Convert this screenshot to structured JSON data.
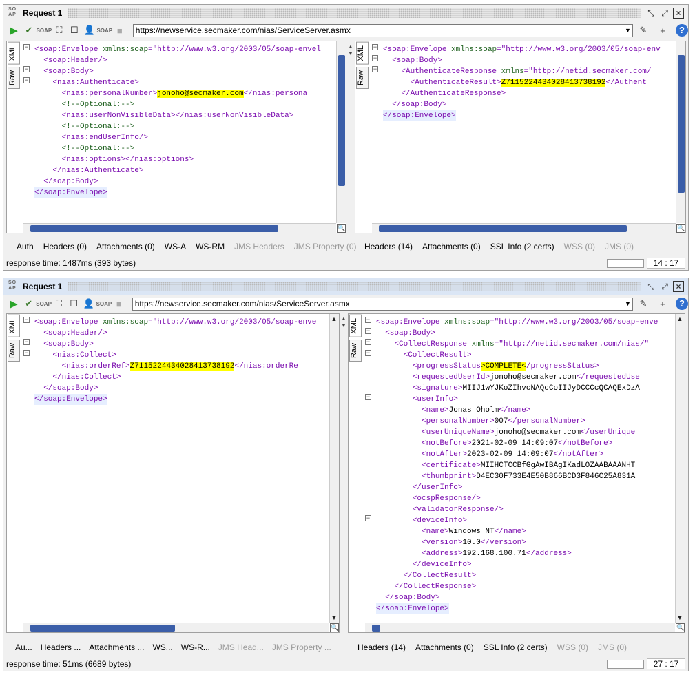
{
  "panel1": {
    "logo": "SO AP",
    "title": "Request 1",
    "url": "https://newservice.secmaker.com/nias/ServiceServer.asmx",
    "left_tabs": [
      "XML",
      "Raw"
    ],
    "right_tabs": [
      "XML",
      "Raw"
    ],
    "req_lines": [
      [
        [
          "t",
          "<soap:Envelope "
        ],
        [
          "a",
          "xmlns:soap"
        ],
        [
          "t",
          "="
        ],
        [
          "v",
          "\"http://www.w3.org/2003/05/soap-envel"
        ]
      ],
      [
        [
          "sp",
          "  "
        ],
        [
          "t",
          "<soap:Header/>"
        ]
      ],
      [
        [
          "sp",
          "  "
        ],
        [
          "t",
          "<soap:Body>"
        ]
      ],
      [
        [
          "sp",
          "    "
        ],
        [
          "t",
          "<nias:Authenticate>"
        ]
      ],
      [
        [
          "sp",
          "      "
        ],
        [
          "t",
          "<nias:personalNumber>"
        ],
        [
          "h",
          "jonoho@secmaker.com"
        ],
        [
          "t",
          "</nias:persona"
        ]
      ],
      [
        [
          "sp",
          "      "
        ],
        [
          "c",
          "<!--Optional:-->"
        ]
      ],
      [
        [
          "sp",
          "      "
        ],
        [
          "t",
          "<nias:userNonVisibleData></nias:userNonVisibleData>"
        ]
      ],
      [
        [
          "sp",
          "      "
        ],
        [
          "c",
          "<!--Optional:-->"
        ]
      ],
      [
        [
          "sp",
          "      "
        ],
        [
          "t",
          "<nias:endUserInfo/>"
        ]
      ],
      [
        [
          "sp",
          "      "
        ],
        [
          "c",
          "<!--Optional:-->"
        ]
      ],
      [
        [
          "sp",
          "      "
        ],
        [
          "t",
          "<nias:options></nias:options>"
        ]
      ],
      [
        [
          "sp",
          "    "
        ],
        [
          "t",
          "</nias:Authenticate>"
        ]
      ],
      [
        [
          "sp",
          "  "
        ],
        [
          "t",
          "</soap:Body>"
        ]
      ],
      [
        [
          "s",
          "</soap:Envelope>"
        ]
      ]
    ],
    "resp_lines": [
      [
        [
          "t",
          "<soap:Envelope "
        ],
        [
          "a",
          "xmlns:soap"
        ],
        [
          "t",
          "="
        ],
        [
          "v",
          "\"http://www.w3.org/2003/05/soap-env"
        ]
      ],
      [
        [
          "sp",
          "  "
        ],
        [
          "t",
          "<soap:Body>"
        ]
      ],
      [
        [
          "sp",
          "    "
        ],
        [
          "t",
          "<AuthenticateResponse "
        ],
        [
          "a",
          "xmlns"
        ],
        [
          "t",
          "="
        ],
        [
          "v",
          "\"http://netid.secmaker.com/"
        ]
      ],
      [
        [
          "sp",
          "      "
        ],
        [
          "t",
          "<AuthenticateResult>"
        ],
        [
          "h",
          "Z7115224434028413738192"
        ],
        [
          "t",
          "</Authent"
        ]
      ],
      [
        [
          "sp",
          "    "
        ],
        [
          "t",
          "</AuthenticateResponse>"
        ]
      ],
      [
        [
          "sp",
          "  "
        ],
        [
          "t",
          "</soap:Body>"
        ]
      ],
      [
        [
          "s",
          "</soap:Envelope>"
        ]
      ]
    ],
    "req_tabs": [
      [
        "Auth",
        0
      ],
      [
        "Headers (0)",
        0
      ],
      [
        "Attachments (0)",
        0
      ],
      [
        "WS-A",
        0
      ],
      [
        "WS-RM",
        0
      ],
      [
        "JMS Headers",
        1
      ],
      [
        "JMS Property (0)",
        1
      ]
    ],
    "resp_tabs": [
      [
        "Headers (14)",
        0
      ],
      [
        "Attachments (0)",
        0
      ],
      [
        "SSL Info (2 certs)",
        0
      ],
      [
        "WSS (0)",
        1
      ],
      [
        "JMS (0)",
        1
      ]
    ],
    "status": "response time: 1487ms (393 bytes)",
    "pos": "14 : 17"
  },
  "panel2": {
    "logo": "SO AP",
    "title": "Request 1",
    "url": "https://newservice.secmaker.com/nias/ServiceServer.asmx",
    "left_tabs": [
      "XML",
      "Raw"
    ],
    "right_tabs": [
      "XML",
      "Raw"
    ],
    "req_lines": [
      [
        [
          "t",
          "<soap:Envelope "
        ],
        [
          "a",
          "xmlns:soap"
        ],
        [
          "t",
          "="
        ],
        [
          "v",
          "\"http://www.w3.org/2003/05/soap-enve"
        ]
      ],
      [
        [
          "sp",
          "  "
        ],
        [
          "t",
          "<soap:Header/>"
        ]
      ],
      [
        [
          "sp",
          "  "
        ],
        [
          "t",
          "<soap:Body>"
        ]
      ],
      [
        [
          "sp",
          "    "
        ],
        [
          "t",
          "<nias:Collect>"
        ]
      ],
      [
        [
          "sp",
          "      "
        ],
        [
          "t",
          "<nias:orderRef>"
        ],
        [
          "h",
          "Z7115224434028413738192"
        ],
        [
          "t",
          "</nias:orderRe"
        ]
      ],
      [
        [
          "sp",
          "    "
        ],
        [
          "t",
          "</nias:Collect>"
        ]
      ],
      [
        [
          "sp",
          "  "
        ],
        [
          "t",
          "</soap:Body>"
        ]
      ],
      [
        [
          "s",
          "</soap:Envelope>"
        ]
      ]
    ],
    "resp_lines": [
      [
        [
          "t",
          "<soap:Envelope "
        ],
        [
          "a",
          "xmlns:soap"
        ],
        [
          "t",
          "="
        ],
        [
          "v",
          "\"http://www.w3.org/2003/05/soap-enve"
        ]
      ],
      [
        [
          "sp",
          "  "
        ],
        [
          "t",
          "<soap:Body>"
        ]
      ],
      [
        [
          "sp",
          "    "
        ],
        [
          "t",
          "<CollectResponse "
        ],
        [
          "a",
          "xmlns"
        ],
        [
          "t",
          "="
        ],
        [
          "v",
          "\"http://netid.secmaker.com/nias/\""
        ]
      ],
      [
        [
          "sp",
          "      "
        ],
        [
          "t",
          "<CollectResult>"
        ]
      ],
      [
        [
          "sp",
          "        "
        ],
        [
          "t",
          "<progressStatus"
        ],
        [
          "h",
          ">COMPLETE<"
        ],
        [
          "t",
          "/progressStatus>"
        ]
      ],
      [
        [
          "sp",
          "        "
        ],
        [
          "t",
          "<requestedUserId>"
        ],
        [
          "x",
          "jonoho@secmaker.com"
        ],
        [
          "t",
          "</requestedUse"
        ]
      ],
      [
        [
          "sp",
          "        "
        ],
        [
          "t",
          "<signature>"
        ],
        [
          "x",
          "MIIJ1wYJKoZIhvcNAQcCoIIJyDCCCcQCAQExDzA"
        ]
      ],
      [
        [
          "sp",
          "        "
        ],
        [
          "t",
          "<userInfo>"
        ]
      ],
      [
        [
          "sp",
          "          "
        ],
        [
          "t",
          "<name>"
        ],
        [
          "x",
          "Jonas Öholm"
        ],
        [
          "t",
          "</name>"
        ]
      ],
      [
        [
          "sp",
          "          "
        ],
        [
          "t",
          "<personalNumber>"
        ],
        [
          "x",
          "007"
        ],
        [
          "t",
          "</personalNumber>"
        ]
      ],
      [
        [
          "sp",
          "          "
        ],
        [
          "t",
          "<userUniqueName>"
        ],
        [
          "x",
          "jonoho@secmaker.com"
        ],
        [
          "t",
          "</userUnique"
        ]
      ],
      [
        [
          "sp",
          "          "
        ],
        [
          "t",
          "<notBefore>"
        ],
        [
          "x",
          "2021-02-09 14:09:07"
        ],
        [
          "t",
          "</notBefore>"
        ]
      ],
      [
        [
          "sp",
          "          "
        ],
        [
          "t",
          "<notAfter>"
        ],
        [
          "x",
          "2023-02-09 14:09:07"
        ],
        [
          "t",
          "</notAfter>"
        ]
      ],
      [
        [
          "sp",
          "          "
        ],
        [
          "t",
          "<certificate>"
        ],
        [
          "x",
          "MIIHCTCCBfGgAwIBAgIKadLOZAABAAANHT"
        ]
      ],
      [
        [
          "sp",
          "          "
        ],
        [
          "t",
          "<thumbprint>"
        ],
        [
          "x",
          "D4EC30F733E4E50B866BCD3F846C25A831A"
        ]
      ],
      [
        [
          "sp",
          "        "
        ],
        [
          "t",
          "</userInfo>"
        ]
      ],
      [
        [
          "sp",
          "        "
        ],
        [
          "t",
          "<ocspResponse/>"
        ]
      ],
      [
        [
          "sp",
          "        "
        ],
        [
          "t",
          "<validatorResponse/>"
        ]
      ],
      [
        [
          "sp",
          "        "
        ],
        [
          "t",
          "<deviceInfo>"
        ]
      ],
      [
        [
          "sp",
          "          "
        ],
        [
          "t",
          "<name>"
        ],
        [
          "x",
          "Windows NT"
        ],
        [
          "t",
          "</name>"
        ]
      ],
      [
        [
          "sp",
          "          "
        ],
        [
          "t",
          "<version>"
        ],
        [
          "x",
          "10.0"
        ],
        [
          "t",
          "</version>"
        ]
      ],
      [
        [
          "sp",
          "          "
        ],
        [
          "t",
          "<address>"
        ],
        [
          "x",
          "192.168.100.71"
        ],
        [
          "t",
          "</address>"
        ]
      ],
      [
        [
          "sp",
          "        "
        ],
        [
          "t",
          "</deviceInfo>"
        ]
      ],
      [
        [
          "sp",
          "      "
        ],
        [
          "t",
          "</CollectResult>"
        ]
      ],
      [
        [
          "sp",
          "    "
        ],
        [
          "t",
          "</CollectResponse>"
        ]
      ],
      [
        [
          "sp",
          "  "
        ],
        [
          "t",
          "</soap:Body>"
        ]
      ],
      [
        [
          "s",
          "</soap:Envelope>"
        ]
      ]
    ],
    "req_tabs": [
      [
        "Au...",
        0
      ],
      [
        "Headers ...",
        0
      ],
      [
        "Attachments ...",
        0
      ],
      [
        "WS...",
        0
      ],
      [
        "WS-R...",
        0
      ],
      [
        "JMS Head...",
        1
      ],
      [
        "JMS Property ...",
        1
      ]
    ],
    "resp_tabs": [
      [
        "Headers (14)",
        0
      ],
      [
        "Attachments (0)",
        0
      ],
      [
        "SSL Info (2 certs)",
        0
      ],
      [
        "WSS (0)",
        1
      ],
      [
        "JMS (0)",
        1
      ]
    ],
    "status": "response time: 51ms (6689 bytes)",
    "pos": "27 : 17"
  }
}
